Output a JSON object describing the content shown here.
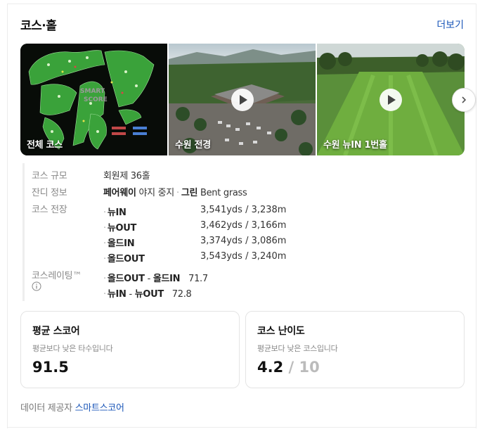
{
  "header": {
    "title": "코스·홀",
    "more_label": "더보기"
  },
  "gallery": {
    "items": [
      {
        "caption": "전체 코스",
        "media": "course-map-image",
        "video": false
      },
      {
        "caption": "수원 전경",
        "media": "aerial-clubhouse-photo",
        "video": true
      },
      {
        "caption": "수원 뉴IN 1번홀",
        "media": "fairway-photo",
        "video": true
      }
    ],
    "next_icon": "chevron-right-icon"
  },
  "info": {
    "scale_label": "코스 규모",
    "scale_value": "회원제 36홀",
    "turf_label": "잔디 정보",
    "turf_fairway_label": "페어웨이",
    "turf_fairway_value": "야지 중지",
    "turf_green_label": "그린",
    "turf_green_value": "Bent grass",
    "length_label": "코스 전장",
    "lengths": [
      {
        "name": "뉴IN",
        "value": "3,541yds / 3,238m"
      },
      {
        "name": "뉴OUT",
        "value": "3,462yds / 3,166m"
      },
      {
        "name": "올드IN",
        "value": "3,374yds / 3,086m"
      },
      {
        "name": "올드OUT",
        "value": "3,543yds / 3,240m"
      }
    ],
    "rating_label": "코스레이팅™",
    "rating_info_icon": "info-circle-icon",
    "ratings": [
      {
        "a": "올드OUT",
        "b": "올드IN",
        "value": "71.7"
      },
      {
        "a": "뉴IN",
        "b": "뉴OUT",
        "value": "72.8"
      }
    ]
  },
  "stats": {
    "avg_score": {
      "title": "평균 스코어",
      "sub": "평균보다 낮은 타수입니다",
      "value": "91.5"
    },
    "difficulty": {
      "title": "코스 난이도",
      "sub": "평균보다 낮은 코스입니다",
      "value": "4.2",
      "max": "/ 10"
    }
  },
  "footer": {
    "provider_label": "데이터 제공자",
    "provider_name": "스마트스코어"
  },
  "colors": {
    "link": "#1a56b8",
    "fairway_green": "#3aa23a",
    "map_bg": "#0b1a0b"
  }
}
